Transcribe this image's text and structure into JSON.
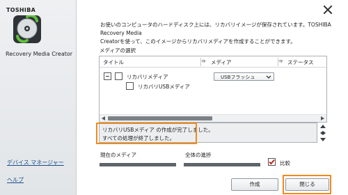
{
  "sidebar": {
    "brand": "TOSHIBA",
    "app_name": "Recovery Media Creator",
    "links": [
      "デバイス マネージャー",
      "ヘルプ"
    ]
  },
  "main": {
    "description_line1": "お使いのコンピュータのハードディスク上には、リカバリイメージが保存されています。TOSHIBA Recovery Media",
    "description_line2": "Creatorを使って、このイメージからリカバリメディアを作成することができます。",
    "media_select_label": "メディアの選択",
    "columns": [
      "タイトル",
      "メディア",
      "ステータス"
    ],
    "rows": [
      {
        "label": "リカバリメディア",
        "media": "USBフラッシュ"
      },
      {
        "label": "リカバリUSBメディア"
      }
    ],
    "status_lines": [
      "リカバリUSBメディア の作成が完了しました。",
      "すべての処理が終了しました。"
    ],
    "current_media_label": "現在のメディア",
    "overall_progress_label": "全体の進捗",
    "current_progress": 1.0,
    "overall_progress": 1.0,
    "compare_label": "比較",
    "compare_checked": true
  },
  "buttons": {
    "create": "作成",
    "close": "閉じる"
  },
  "colors": {
    "highlight": "#f08a1c",
    "check": "#c0281e",
    "link": "#1a4c8a"
  },
  "icons": [
    "close-icon",
    "disc-recovery-icon",
    "dropdown-arrow-icon",
    "column-resize-icon",
    "checkmark-icon"
  ]
}
